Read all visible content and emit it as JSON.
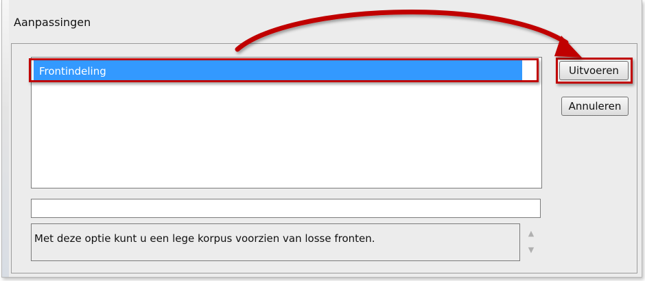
{
  "dialog": {
    "title": "Aanpassingen"
  },
  "list": {
    "items": [
      {
        "label": "Frontindeling",
        "selected": true
      }
    ]
  },
  "buttons": {
    "run_label": "Uitvoeren",
    "cancel_label": "Annuleren"
  },
  "input": {
    "value": ""
  },
  "description": {
    "text": "Met deze optie kunt u een lege korpus voorzien van losse fronten."
  },
  "colors": {
    "selection": "#3399ff",
    "annotation": "#c00000",
    "dialog_bg": "#ececec"
  },
  "icons": {
    "scroll_up": "scroll-up-icon",
    "scroll_down": "scroll-down-icon",
    "annotation_arrow": "curved-arrow-icon"
  }
}
